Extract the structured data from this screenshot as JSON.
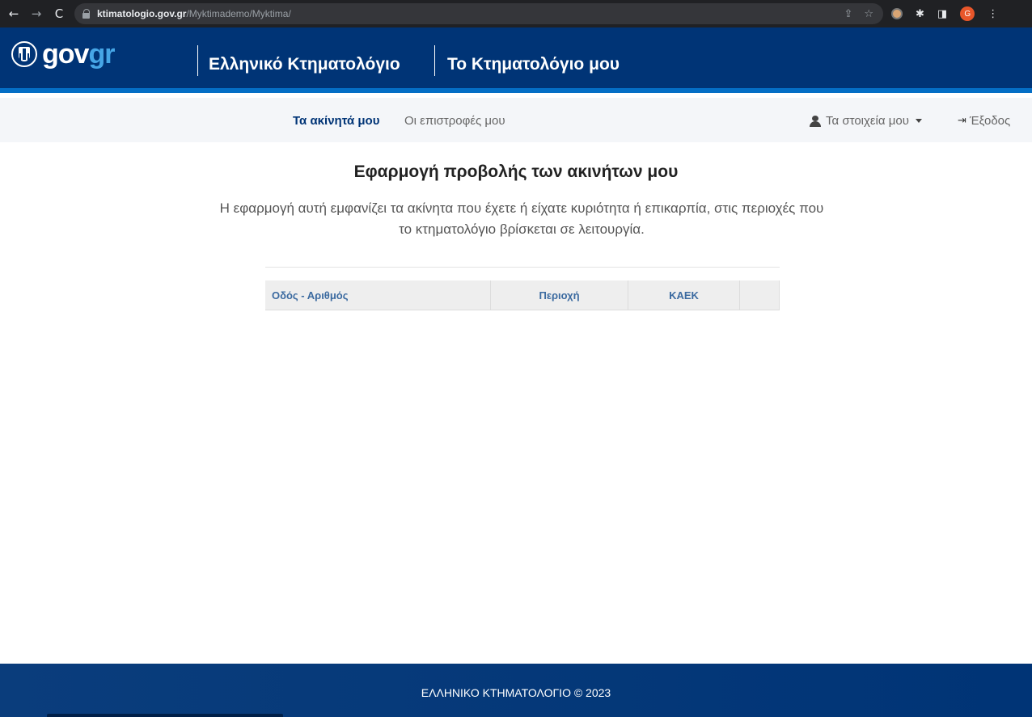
{
  "browser": {
    "back_glyph": "←",
    "forward_glyph": "→",
    "reload_glyph": "C",
    "url_host": "ktimatologio.gov.gr",
    "url_path": "/Myktimademo/Myktima/",
    "share_glyph": "⇪",
    "star_glyph": "☆",
    "puzzle_glyph": "✱",
    "panel_glyph": "◨",
    "profile_initial": "G",
    "menu_glyph": "⋮"
  },
  "header": {
    "logo_gov": "gov",
    "logo_gr": "gr",
    "title_1": "Ελληνικό Κτηματολόγιο",
    "title_2": "Το Κτηματολόγιο μου"
  },
  "subnav": {
    "tab_properties": "Τα ακίνητά μου",
    "tab_returns": "Οι επιστροφές μου",
    "my_details": "Τα στοιχεία μου",
    "logout": "Έξοδος"
  },
  "main": {
    "title": "Εφαρμογή προβολής των ακινήτων μου",
    "intro_line1": "Η εφαρμογή αυτή εμφανίζει τα ακίνητα που έχετε ή είχατε κυριότητα ή επικαρπία, στις περιοχές που",
    "intro_line2": "το κτηματολόγιο βρίσκεται σε λειτουργία.",
    "table": {
      "columns": [
        "Οδός - Αριθμός",
        "Περιοχή",
        "ΚΑΕΚ",
        ""
      ],
      "rows": []
    }
  },
  "footer": {
    "text": "ΕΛΛΗΝΙΚΟ ΚΤΗΜΑΤΟΛΟΓΙΟ © 2023"
  },
  "colors": {
    "brand_blue": "#003476",
    "accent_blue": "#046ec5",
    "gr_blue": "#46a6e6"
  }
}
